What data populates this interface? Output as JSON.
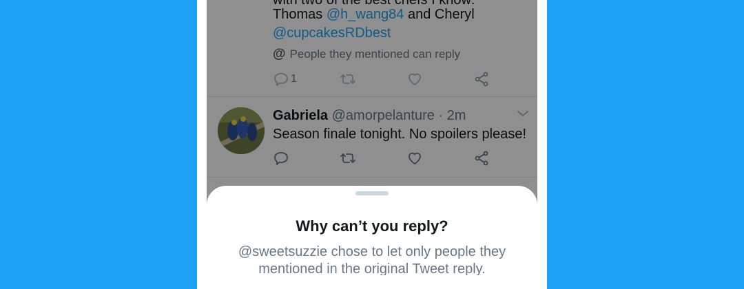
{
  "colors": {
    "background": "#1da1f2",
    "accent": "#1da1f2",
    "text_primary": "#14171a",
    "text_secondary": "#657786"
  },
  "tweet1": {
    "line_partial": "with two of the best chefs I know:",
    "line2_prefix": "Thomas ",
    "mention1": "@h_wang84",
    "line2_mid": " and Cheryl",
    "mention2": "@cupcakesRDbest",
    "reply_restriction": "People they mentioned can reply",
    "reply_count": "1",
    "icons": [
      "reply-icon",
      "retweet-icon",
      "like-icon",
      "share-icon"
    ]
  },
  "tweet2": {
    "name": "Gabriela",
    "handle": "@amorpelanture",
    "separator": " · ",
    "time": "2m",
    "text": "Season finale tonight. No spoilers please!",
    "icons": [
      "reply-icon",
      "retweet-icon",
      "like-icon",
      "share-icon",
      "chevron-down-icon"
    ]
  },
  "sheet": {
    "title": "Why can’t you reply?",
    "body_line1": "@sweetsuzzie chose to let only people they",
    "body_line2": "mentioned in the original Tweet reply."
  }
}
